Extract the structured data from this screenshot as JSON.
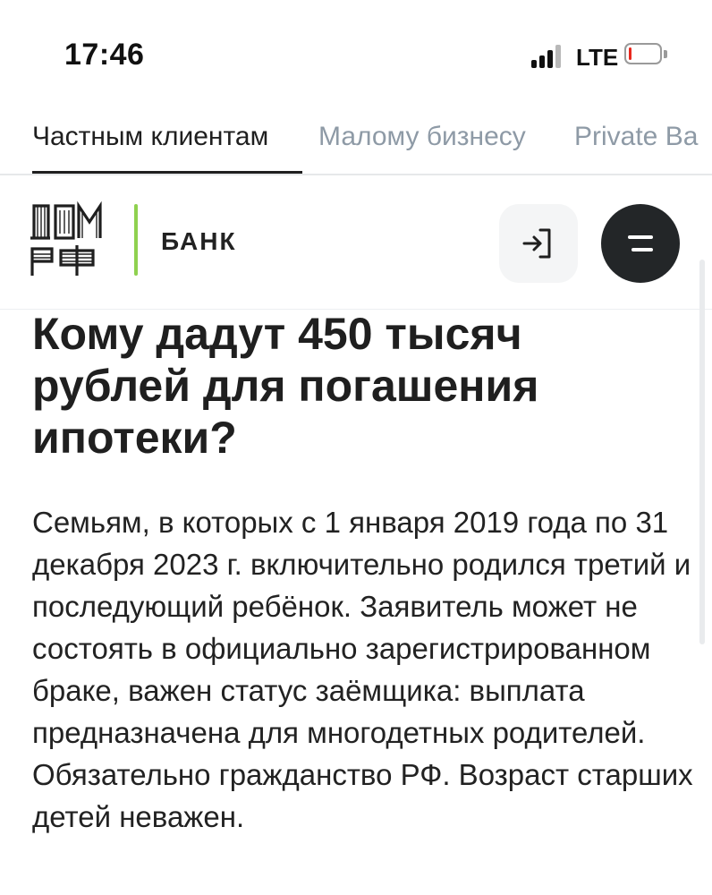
{
  "status_bar": {
    "time": "17:46",
    "network": "LTE",
    "battery_level": 0.1,
    "battery_color": "#e8281e",
    "signal_bars": 4
  },
  "segment_tabs": [
    {
      "label": "Частным клиентам",
      "active": true
    },
    {
      "label": "Малому бизнесу",
      "active": false
    },
    {
      "label": "Private Ba",
      "active": false
    }
  ],
  "header": {
    "logo_icon": "dom-rf-logo",
    "bank_label": "БАНК",
    "accent_color": "#8fd14f",
    "login_icon": "login-icon",
    "menu_icon": "menu-icon"
  },
  "article": {
    "title": "Кому дадут 450 тысяч рублей для погашения ипотеки?",
    "body": "Семьям, в которых с 1 января 2019 года по 31 декабря 2023 г. включительно родился третий и последующий ребёнок. Заявитель может не состоять в официально зарегистрированном браке, важен статус заёмщика: выплата предназначена для многодетных родителей. Обязательно гражданство РФ. Возраст старших детей неважен."
  }
}
